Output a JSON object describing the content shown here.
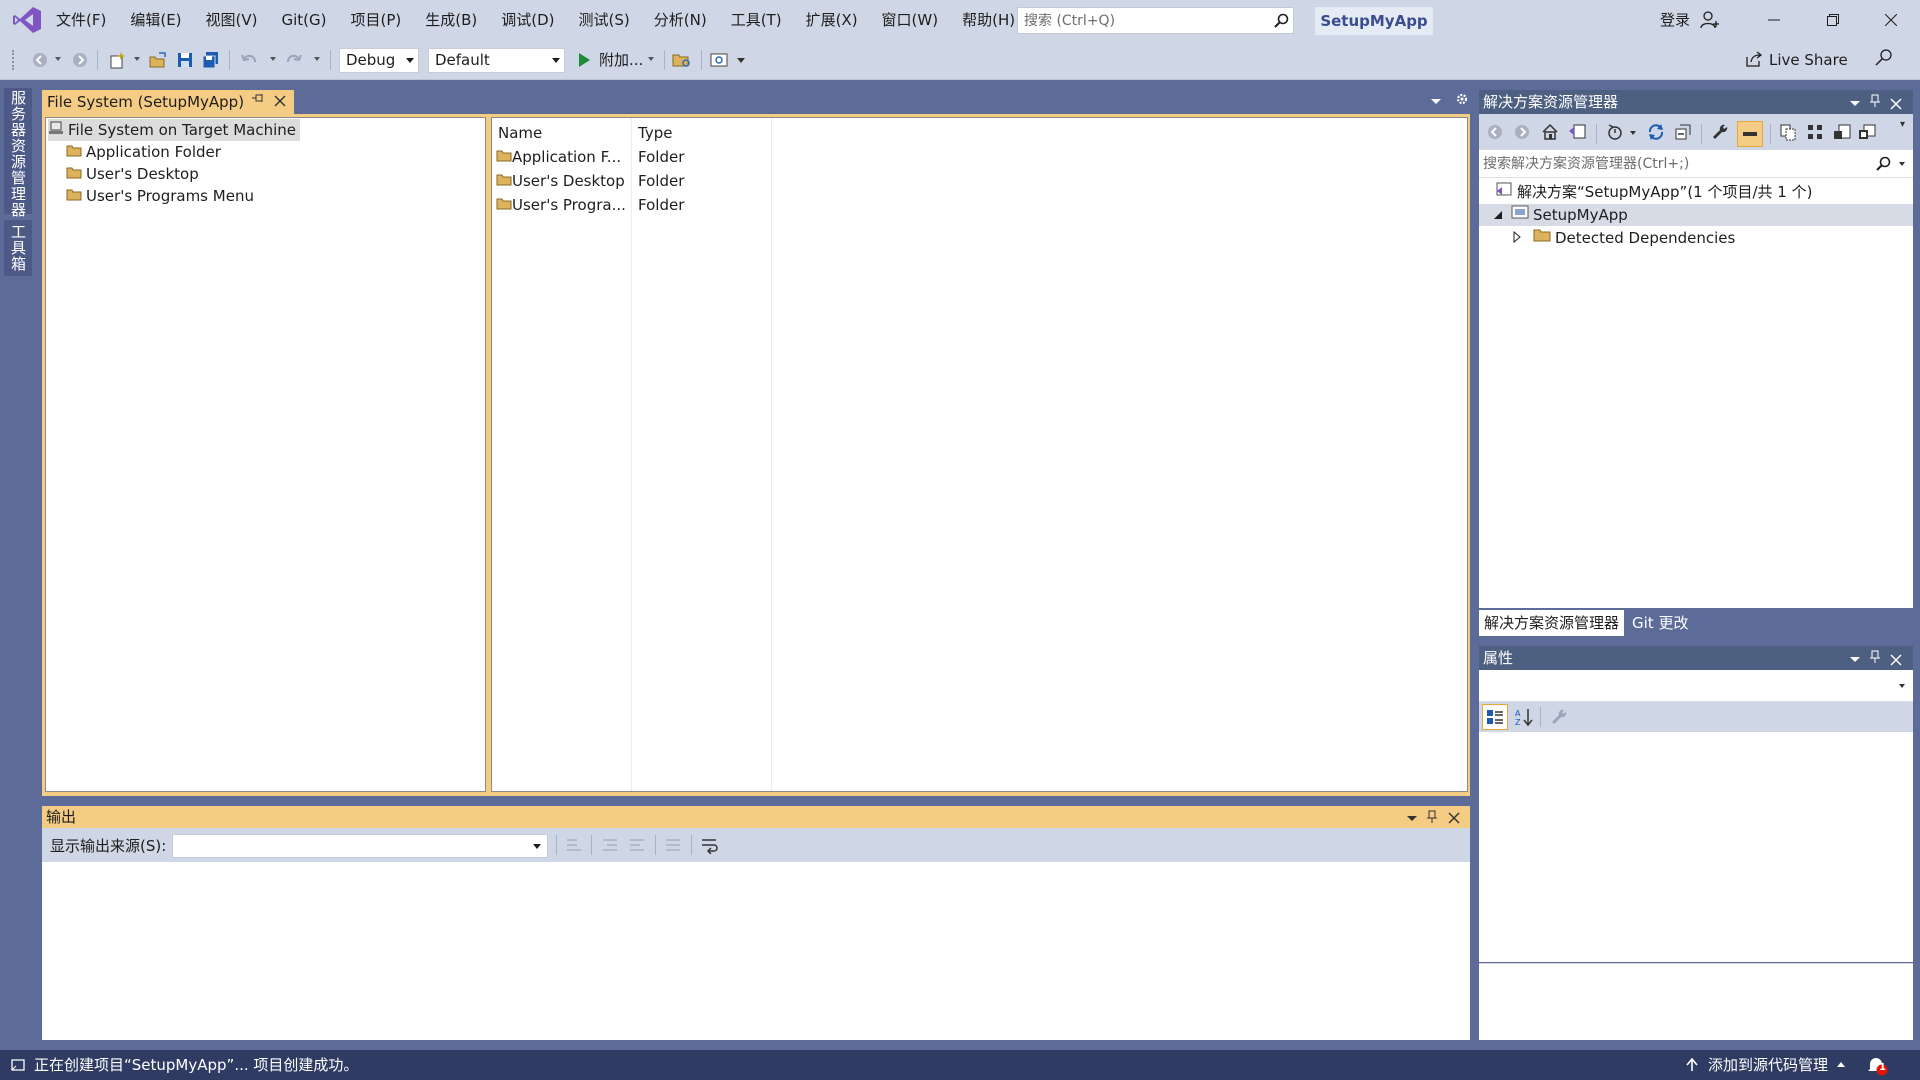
{
  "app": {
    "solution_name": "SetupMyApp",
    "login": "登录"
  },
  "menu": [
    "文件(F)",
    "编辑(E)",
    "视图(V)",
    "Git(G)",
    "项目(P)",
    "生成(B)",
    "调试(D)",
    "测试(S)",
    "分析(N)",
    "工具(T)",
    "扩展(X)",
    "窗口(W)",
    "帮助(H)"
  ],
  "search": {
    "placeholder": "搜索 (Ctrl+Q)"
  },
  "toolbar": {
    "config": "Debug",
    "platform": "Default",
    "attach_label": "附加...",
    "live_share": "Live Share"
  },
  "left_tool_tabs": [
    "服务器资源管理器",
    "工具箱"
  ],
  "document": {
    "tab_title": "File System (SetupMyApp)",
    "tree_root": "File System on Target Machine",
    "tree_children": [
      "Application Folder",
      "User's Desktop",
      "User's Programs Menu"
    ],
    "list_columns": [
      "Name",
      "Type"
    ],
    "list_rows": [
      {
        "name": "Application F...",
        "type": "Folder"
      },
      {
        "name": "User's Desktop",
        "type": "Folder"
      },
      {
        "name": "User's Progra...",
        "type": "Folder"
      }
    ]
  },
  "output": {
    "title": "输出",
    "source_label": "显示输出来源(S):",
    "source_value": ""
  },
  "solution_explorer": {
    "title": "解决方案资源管理器",
    "search_placeholder": "搜索解决方案资源管理器(Ctrl+;)",
    "solution_node": "解决方案“SetupMyApp”(1 个项目/共 1 个)",
    "project_node": "SetupMyApp",
    "dependencies_node": "Detected Dependencies",
    "tabs": [
      "解决方案资源管理器",
      "Git 更改"
    ]
  },
  "properties": {
    "title": "属性"
  },
  "status": {
    "message": "正在创建项目“SetupMyApp”... 项目创建成功。",
    "source_control": "添加到源代码管理",
    "notification_count": "1"
  },
  "colors": {
    "chrome": "#cfd6e5",
    "frame": "#5d6b99",
    "doc_accent": "#f5cc84",
    "tool_header": "#4d6082",
    "status_bar": "#2f3b63"
  }
}
